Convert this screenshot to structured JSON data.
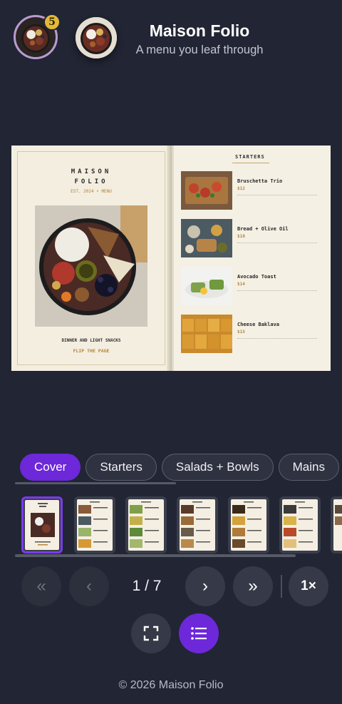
{
  "header": {
    "title": "Maison Folio",
    "subtitle": "A menu you leaf through",
    "badge_count": "5",
    "avatar_primary": "charcuterie-board-avatar",
    "avatar_secondary": "charcuterie-board-avatar"
  },
  "book": {
    "cover": {
      "name_line1": "MAISON",
      "name_line2": "FOLIO",
      "established": "EST. 2024 • MENU",
      "tagline": "DINNER AND LIGHT SNACKS",
      "cta": "FLIP THE PAGE"
    },
    "starters": {
      "heading": "STARTERS",
      "items": [
        {
          "name": "Bruschetta Trio",
          "price": "$12"
        },
        {
          "name": "Bread + Olive Oil",
          "price": "$10"
        },
        {
          "name": "Avocado Toast",
          "price": "$14"
        },
        {
          "name": "Cheese Baklava",
          "price": "$15"
        }
      ]
    }
  },
  "tabs": [
    "Cover",
    "Starters",
    "Salads + Bowls",
    "Mains"
  ],
  "active_tab": "Cover",
  "thumbnails_count": 7,
  "pager": {
    "current": "1",
    "total": "7",
    "label": "1 / 7"
  },
  "controls": {
    "first": "«",
    "prev": "‹",
    "next": "›",
    "last": "»",
    "speed": "1×",
    "fullscreen_icon": "fullscreen-icon",
    "list_icon": "list-icon"
  },
  "footer": "© 2026 Maison Folio",
  "colors": {
    "accent": "#6d28d9",
    "background": "#212534",
    "gold": "#b8843a"
  }
}
